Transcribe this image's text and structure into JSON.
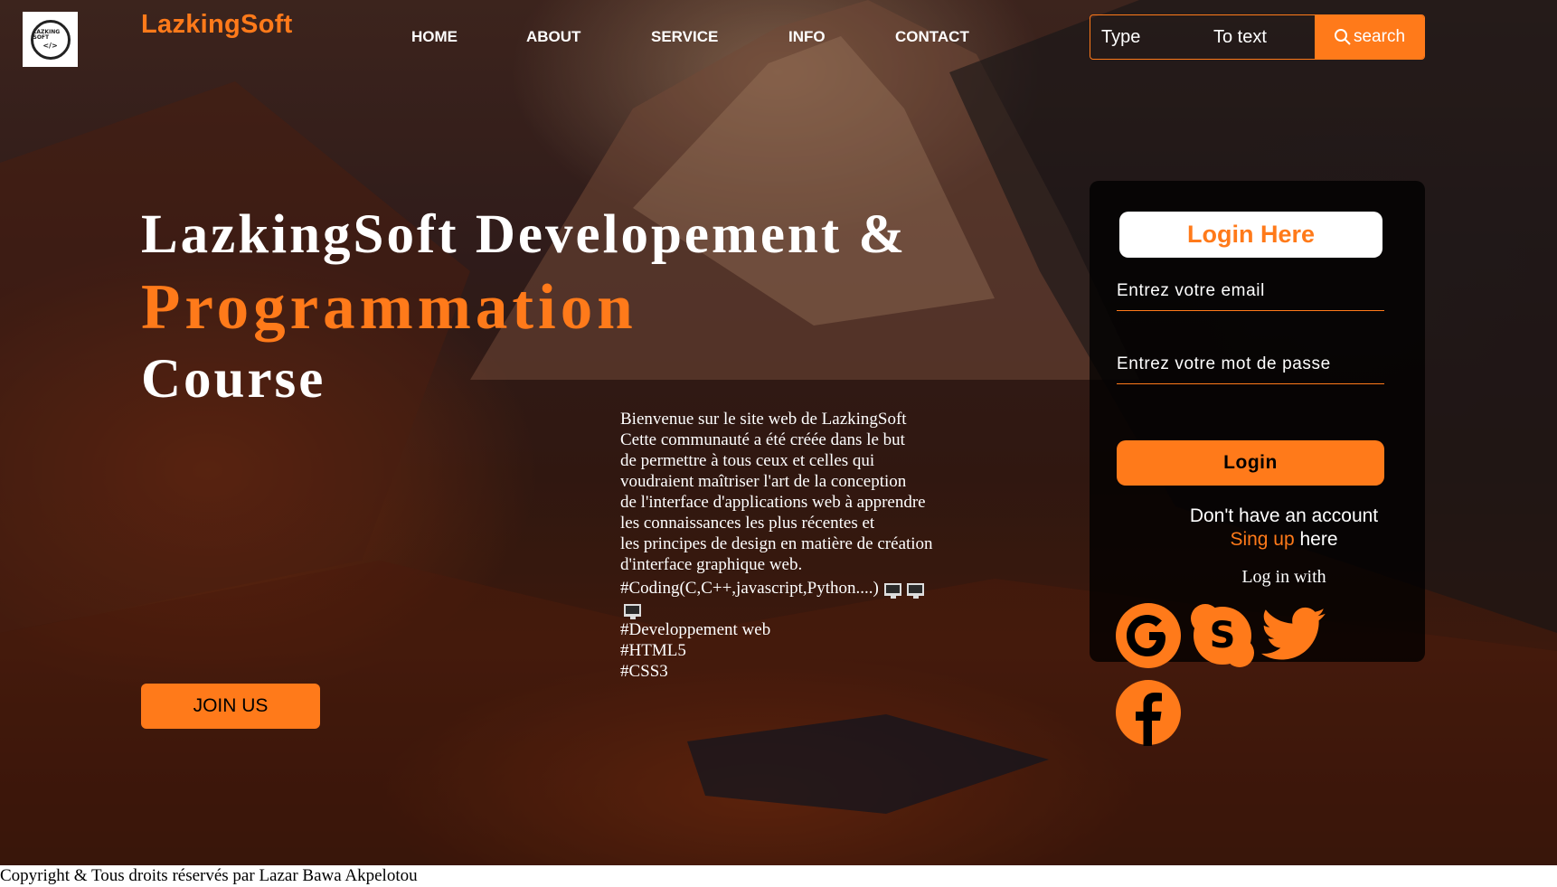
{
  "header": {
    "logo_text": "LAZKING SOFT",
    "brand": "LazkingSoft",
    "nav": [
      "HOME",
      "ABOUT",
      "SERVICE",
      "INFO",
      "CONTACT"
    ],
    "search": {
      "type_placeholder": "Type",
      "value_placeholder": "To text",
      "button_label": "search"
    }
  },
  "hero": {
    "title_line1": "LazkingSoft Developement &",
    "title_line2": "Programmation",
    "title_line3": "Course",
    "description": [
      "Bienvenue sur le site web de LazkingSoft",
      "Cette communauté a été créée dans le but",
      "de permettre à tous ceux et celles qui",
      "voudraient maîtriser l'art de la conception",
      "de l'interface d'applications web à apprendre",
      "les connaissances les plus récentes et",
      "les principes de design en matière de création",
      "d'interface graphique web."
    ],
    "tags": [
      "#Coding(C,C++,javascript,Python....)",
      "#Developpement web",
      "#HTML5",
      "#CSS3"
    ],
    "join_label": "JOIN US"
  },
  "login": {
    "title": "Login Here",
    "email_placeholder": "Entrez votre email",
    "password_placeholder": "Entrez votre mot de passe",
    "button_label": "Login",
    "no_account": "Don't have an account",
    "signup_link": "Sing up",
    "signup_suffix": " here",
    "login_with": "Log in with"
  },
  "social_icons": [
    "google-icon",
    "skype-icon",
    "twitter-icon",
    "facebook-icon"
  ],
  "footer": {
    "copyright": "Copyright & Tous droits réservés par Lazar Bawa Akpelotou"
  },
  "colors": {
    "accent": "#ff7a1a",
    "panel": "#000000",
    "text": "#ffffff"
  }
}
